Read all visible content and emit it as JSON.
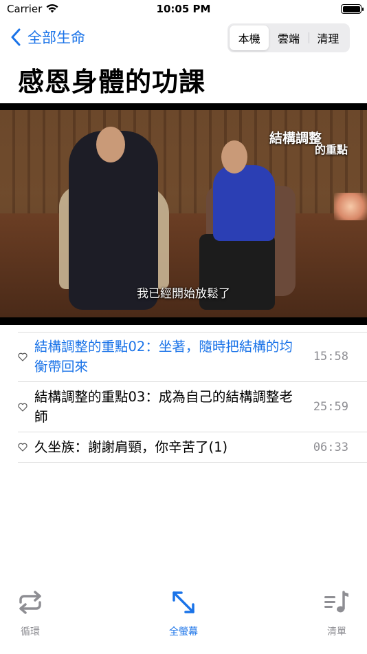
{
  "status_bar": {
    "carrier": "Carrier",
    "time": "10:05 PM",
    "battery_level": 1.0
  },
  "nav": {
    "back_label": "全部生命",
    "segments": [
      {
        "label": "本機",
        "selected": true
      },
      {
        "label": "雲端",
        "selected": false
      },
      {
        "label": "清理",
        "selected": false
      }
    ]
  },
  "page_title": "感恩身體的功課",
  "video": {
    "overlay_title": "結構調整",
    "overlay_subtitle": "的重點",
    "caption": "我已經開始放鬆了"
  },
  "tracks": [
    {
      "title": "結構調整的重點02：坐著，隨時把結構的均衡帶回來",
      "duration": "15:58",
      "current": true,
      "icon": "heart-outline-icon"
    },
    {
      "title": "結構調整的重點03：成為自己的結構調整老師",
      "duration": "25:59",
      "current": false,
      "icon": "heart-outline-icon"
    },
    {
      "title": "久坐族：謝謝肩頸，你辛苦了(1)",
      "duration": "06:33",
      "current": false,
      "icon": "heart-outline-icon"
    }
  ],
  "tab_bar": {
    "loop_label": "循環",
    "fullscreen_label": "全螢幕",
    "playlist_label": "清單"
  },
  "colors": {
    "accent": "#1a73e8",
    "secondary_text": "#8e8e93",
    "divider": "#dcdcdc"
  }
}
